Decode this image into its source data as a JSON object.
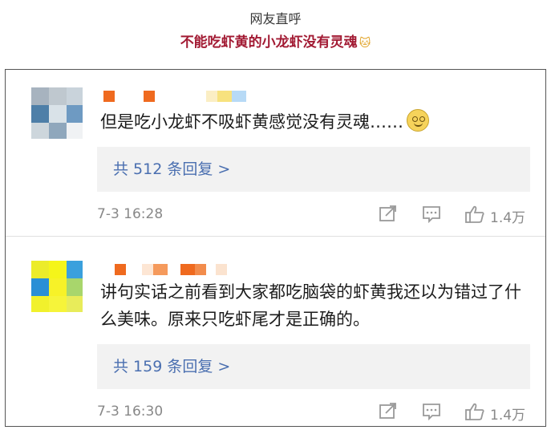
{
  "header": {
    "subtitle": "网友直呼",
    "title": "不能吃虾黄的小龙虾没有灵魂",
    "title_emoji": "🐱"
  },
  "comments": [
    {
      "text": "但是吃小龙虾不吸虾黄感觉没有灵魂……",
      "has_emoji": true,
      "replies_label": "共 512 条回复 >",
      "time": "7-3 16:28",
      "like_count": "1.4万"
    },
    {
      "text": "讲句实话之前看到大家都吃脑袋的虾黄我还以为错过了什么美味。原来只吃虾尾才是正确的。",
      "has_emoji": false,
      "replies_label": "共 159 条回复 >",
      "time": "7-3 16:30",
      "like_count": "1.4万"
    }
  ],
  "colors": {
    "title_red": "#a21a33",
    "reply_link": "#4a6fb0",
    "reply_bg": "#f2f2f2",
    "meta_gray": "#888888"
  },
  "icons": {
    "share": "share-icon",
    "comment": "comment-icon",
    "like": "thumbs-up-icon"
  }
}
